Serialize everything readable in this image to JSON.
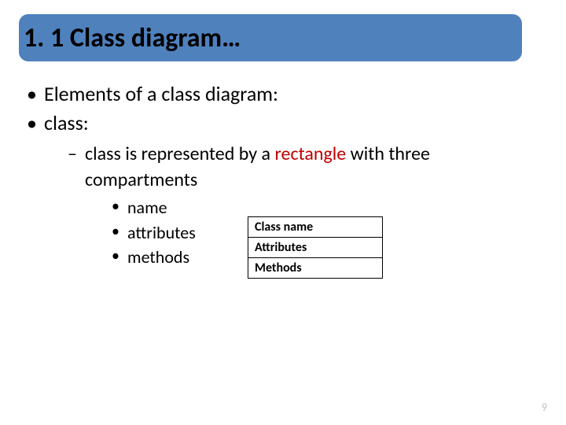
{
  "title": "1. 1 Class diagram…",
  "bullets": {
    "l1a": "Elements of a class diagram:",
    "l1b": "class:",
    "l2a_pre": "class is represented by a ",
    "l2a_hi": "rectangle",
    "l2a_post": " with three compartments",
    "l3a": "name",
    "l3b": "attributes",
    "l3c": "methods"
  },
  "class_box": {
    "r1": "Class name",
    "r2": "Attributes",
    "r3": "Methods"
  },
  "page_number": "9"
}
